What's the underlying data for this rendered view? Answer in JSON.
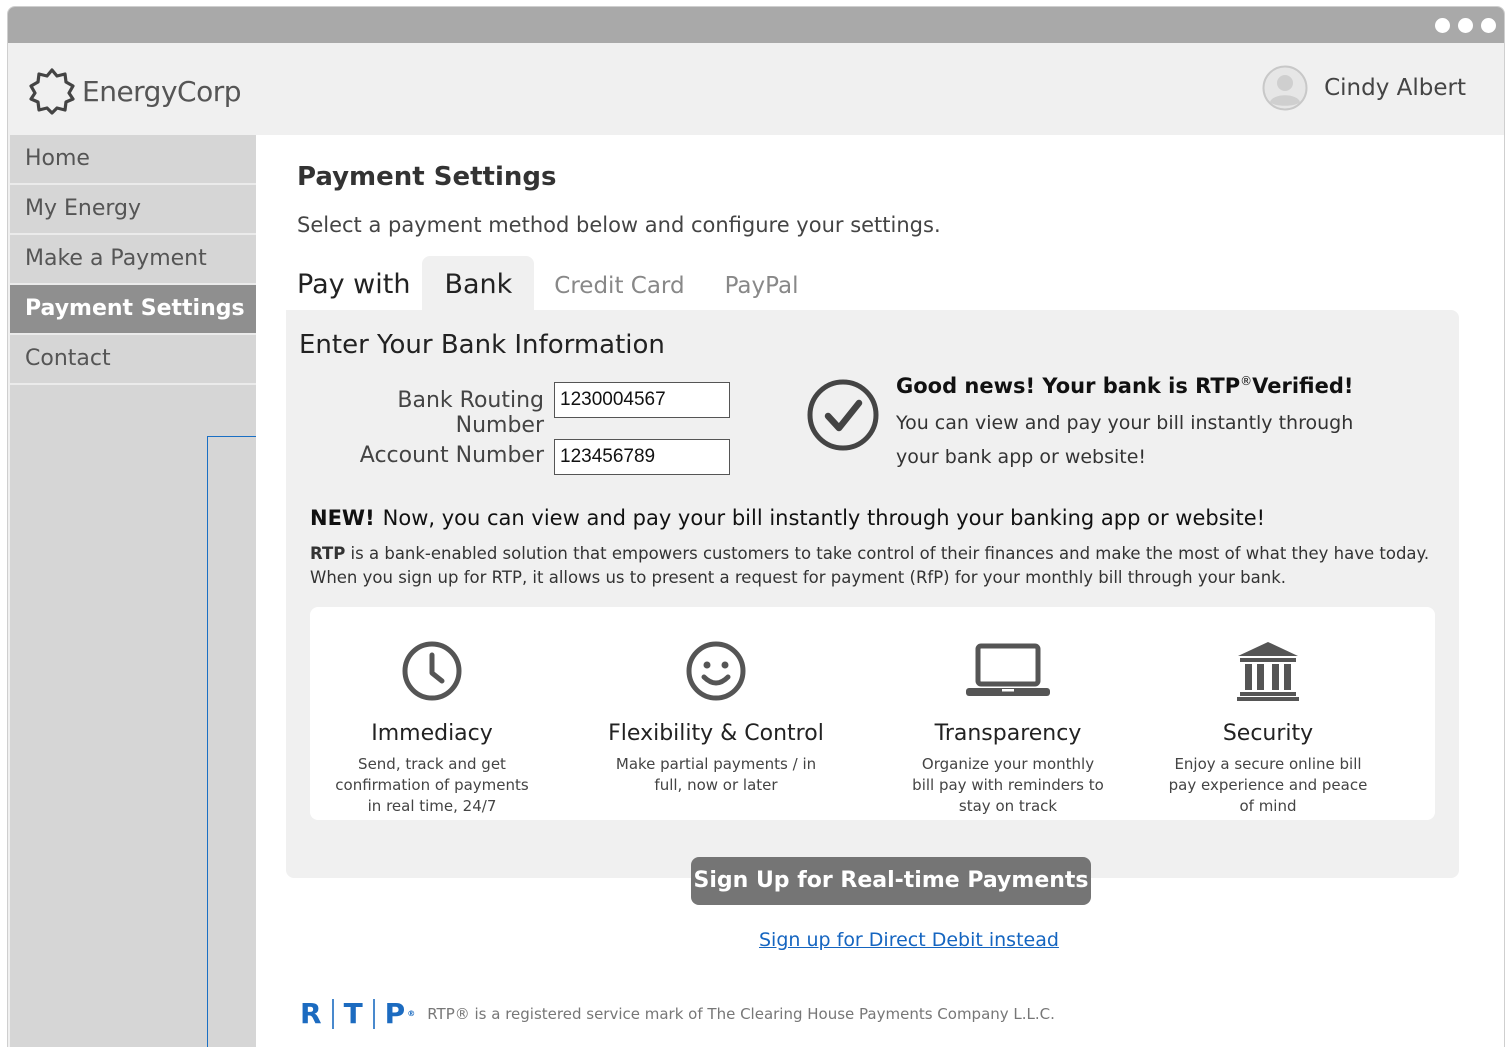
{
  "app": {
    "brand": "EnergyCorp",
    "user_name": "Cindy Albert"
  },
  "sidebar": {
    "items": [
      {
        "label": "Home",
        "active": false
      },
      {
        "label": "My Energy",
        "active": false
      },
      {
        "label": "Make a Payment",
        "active": false
      },
      {
        "label": "Payment Settings",
        "active": true
      },
      {
        "label": "Contact",
        "active": false
      }
    ]
  },
  "page": {
    "title": "Payment Settings",
    "subtitle": "Select a payment method below and configure your settings."
  },
  "tabs": {
    "lead": "Pay with",
    "items": [
      {
        "label": "Bank",
        "active": true
      },
      {
        "label": "Credit Card",
        "active": false
      },
      {
        "label": "PayPal",
        "active": false
      }
    ]
  },
  "bank": {
    "section_title": "Enter Your Bank Information",
    "routing_label": "Bank Routing Number",
    "routing_value": "1230004567",
    "account_label": "Account Number",
    "account_value": "123456789"
  },
  "verified": {
    "title_prefix": "Good news! Your bank is RTP",
    "title_mark": "®",
    "title_suffix": "Verified!",
    "text_line1": "You can view and pay your bill instantly through",
    "text_line2": "your bank app or website!"
  },
  "rtp_info": {
    "heading_new": "NEW!",
    "heading_text": "Now, you can view and pay your bill instantly through your banking app or website!",
    "desc_bold": "RTP",
    "desc_text": " is a bank-enabled solution that empowers customers to take control of their finances and make the most of what they have today. When you sign up for RTP, it allows us to present a request for payment (RfP) for your monthly bill through your bank."
  },
  "features": [
    {
      "icon": "clock-icon",
      "title": "Immediacy",
      "desc_lines": [
        "Send, track and get",
        "confirmation of payments",
        "in real time, 24/7"
      ]
    },
    {
      "icon": "smiley-icon",
      "title": "Flexibility & Control",
      "desc_lines": [
        "Make partial payments / in",
        "full, now or later"
      ]
    },
    {
      "icon": "laptop-icon",
      "title": "Transparency",
      "desc_lines": [
        "Organize your monthly",
        "bill pay with reminders to",
        "stay on track"
      ]
    },
    {
      "icon": "bank-icon",
      "title": "Security",
      "desc_lines": [
        "Enjoy a secure online bill",
        "pay experience and peace",
        "of mind"
      ]
    }
  ],
  "actions": {
    "signup_button": "Sign Up for Real-time Payments",
    "direct_debit_link": "Sign up for Direct Debit instead"
  },
  "footer": {
    "logo_letters": [
      "R",
      "T",
      "P"
    ],
    "logo_mark": "®",
    "text": "RTP® is a registered service mark of The Clearing House Payments Company L.L.C."
  },
  "colors": {
    "titlebar": "#a9a9a9",
    "sidebar_bg": "#d6d6d6",
    "sidebar_active": "#8f8f8f",
    "panel_bg": "#f0f0f0",
    "button_bg": "#757575",
    "link": "#1565c0",
    "rtp_blue": "#1c6bc0"
  }
}
